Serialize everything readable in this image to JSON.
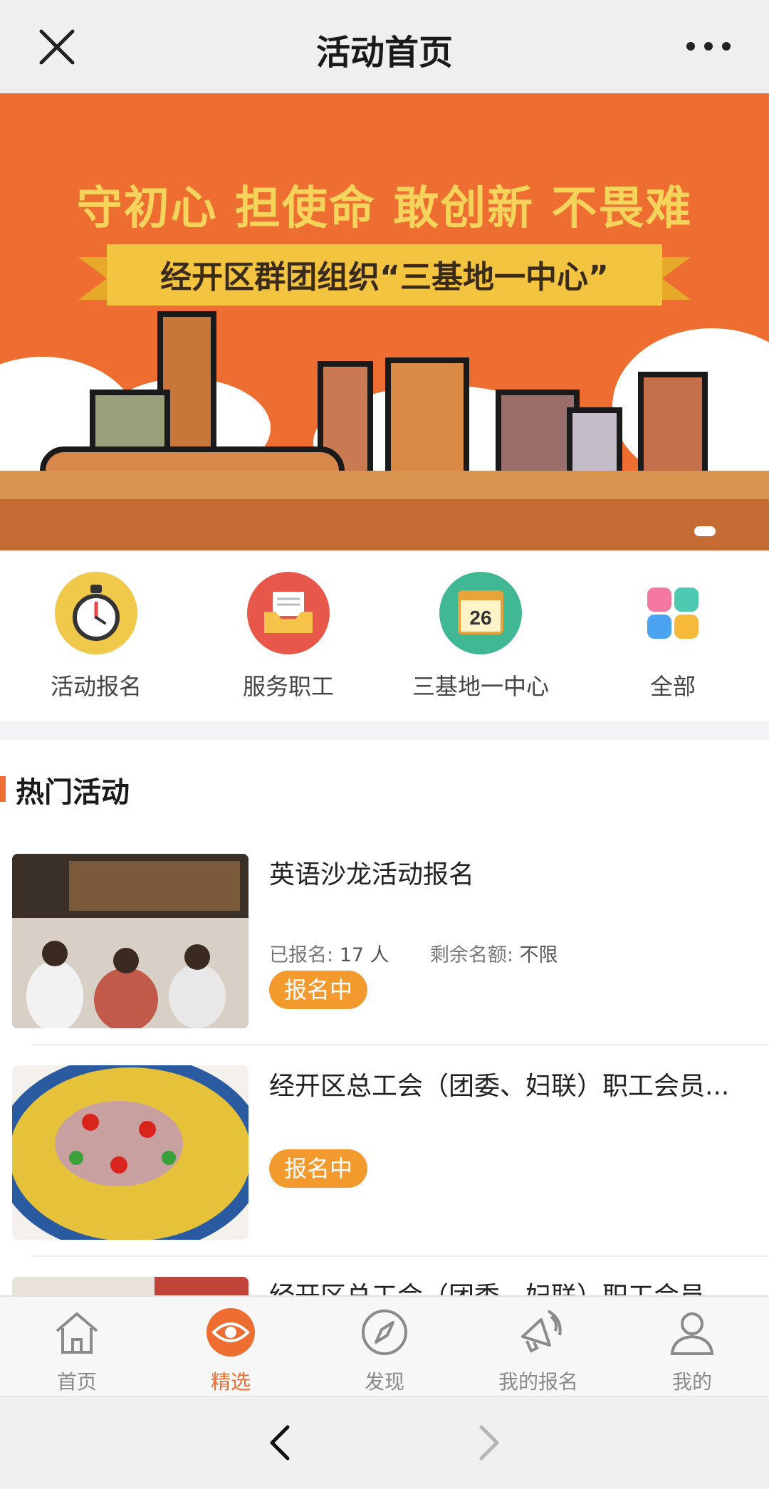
{
  "topbar": {
    "title": "活动首页",
    "close_icon": "close-icon",
    "more_icon": "more-dots-icon"
  },
  "banner": {
    "slogan": "守初心 担使命 敢创新 不畏难",
    "ribbon": "经开区群团组织“三基地一中心”",
    "colors": {
      "background": "#ee6d30",
      "slogan": "#f6d35b",
      "ribbon": "#f3c43f"
    }
  },
  "quick_menu": [
    {
      "label": "活动报名",
      "icon": "stopwatch-icon",
      "color": "#f0c84a"
    },
    {
      "label": "服务职工",
      "icon": "inbox-mail-icon",
      "color": "#e8584a"
    },
    {
      "label": "三基地一中心",
      "icon": "calendar-icon",
      "color": "#3fb893",
      "calendar_day": "26"
    },
    {
      "label": "全部",
      "icon": "grid-apps-icon",
      "color": "#ffffff"
    }
  ],
  "hot": {
    "title": "热门活动",
    "items": [
      {
        "name": "英语沙龙活动报名",
        "registered_label": "已报名:",
        "registered_value": "17 人",
        "remaining_label": "剩余名额:",
        "remaining_value": "不限",
        "status": "报名中",
        "image": "meeting-room-photo"
      },
      {
        "name": "经开区总工会（团委、妇联）职工会员...",
        "status": "报名中",
        "image": "spicy-fish-dish-photo"
      },
      {
        "name": "经开区总工会（团委、妇联）职工会员...",
        "image": "food-photo"
      }
    ]
  },
  "tabbar": {
    "items": [
      {
        "label": "首页",
        "icon": "home-icon",
        "active": false
      },
      {
        "label": "精选",
        "icon": "eye-icon",
        "active": true
      },
      {
        "label": "发现",
        "icon": "compass-icon",
        "active": false
      },
      {
        "label": "我的报名",
        "icon": "megaphone-icon",
        "active": false
      },
      {
        "label": "我的",
        "icon": "user-icon",
        "active": false
      }
    ],
    "active_color": "#ee6d30"
  },
  "browser_nav": {
    "back_icon": "chevron-left-icon",
    "forward_icon": "chevron-right-icon"
  }
}
